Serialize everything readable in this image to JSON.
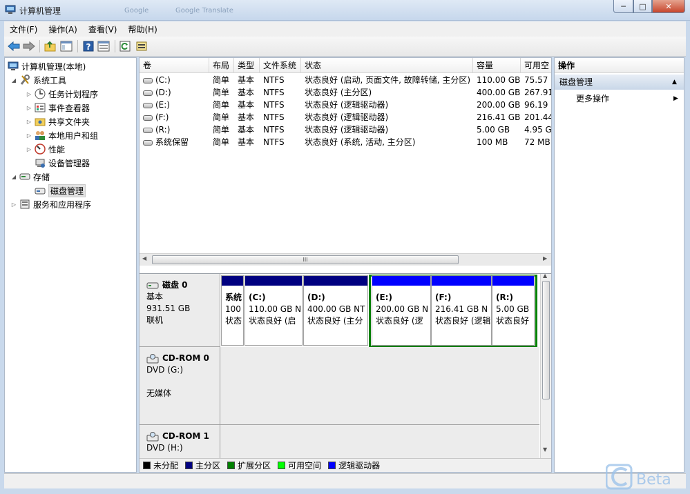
{
  "window": {
    "title": "计算机管理",
    "ghost_tabs": [
      "Google",
      "Google Translate"
    ],
    "minimize": "─",
    "maximize": "□",
    "close": "✕"
  },
  "menu": [
    "文件(F)",
    "操作(A)",
    "查看(V)",
    "帮助(H)"
  ],
  "toolbar_icons": [
    "back-arrow-icon",
    "forward-arrow-icon",
    "up-folder-icon",
    "show-hide-tree-icon",
    "help-icon",
    "properties-icon",
    "refresh-icon",
    "export-icon"
  ],
  "tree": {
    "root": "计算机管理(本地)",
    "system_tools": "系统工具",
    "task_scheduler": "任务计划程序",
    "event_viewer": "事件查看器",
    "shared_folders": "共享文件夹",
    "local_users": "本地用户和组",
    "performance": "性能",
    "device_manager": "设备管理器",
    "storage": "存储",
    "disk_management": "磁盘管理",
    "services_apps": "服务和应用程序"
  },
  "volume_table": {
    "columns": [
      "卷",
      "布局",
      "类型",
      "文件系统",
      "状态",
      "容量",
      "可用空"
    ],
    "rows": [
      [
        "(C:)",
        "简单",
        "基本",
        "NTFS",
        "状态良好 (启动, 页面文件, 故障转储, 主分区)",
        "110.00 GB",
        "75.57"
      ],
      [
        "(D:)",
        "简单",
        "基本",
        "NTFS",
        "状态良好 (主分区)",
        "400.00 GB",
        "267.91"
      ],
      [
        "(E:)",
        "简单",
        "基本",
        "NTFS",
        "状态良好 (逻辑驱动器)",
        "200.00 GB",
        "96.19"
      ],
      [
        "(F:)",
        "简单",
        "基本",
        "NTFS",
        "状态良好 (逻辑驱动器)",
        "216.41 GB",
        "201.44"
      ],
      [
        "(R:)",
        "简单",
        "基本",
        "NTFS",
        "状态良好 (逻辑驱动器)",
        "5.00 GB",
        "4.95 G"
      ],
      [
        "系统保留",
        "简单",
        "基本",
        "NTFS",
        "状态良好 (系统, 活动, 主分区)",
        "100 MB",
        "72 MB"
      ]
    ],
    "scroll_thumb_glyph": "III"
  },
  "disks": {
    "disk0": {
      "name": "磁盘 0",
      "type": "基本",
      "size": "931.51 GB",
      "status": "联机"
    },
    "cdrom0": {
      "name": "CD-ROM 0",
      "type": "DVD (G:)",
      "media": "无媒体"
    },
    "cdrom1": {
      "name": "CD-ROM 1",
      "type": "DVD (H:)"
    }
  },
  "partitions": [
    {
      "name": "系统",
      "size": "100",
      "status": "状态"
    },
    {
      "name": "(C:)",
      "size": "110.00 GB N",
      "status": "状态良好 (启"
    },
    {
      "name": "(D:)",
      "size": "400.00 GB NT",
      "status": "状态良好 (主分"
    },
    {
      "name": "(E:)",
      "size": "200.00 GB N",
      "status": "状态良好 (逻"
    },
    {
      "name": "(F:)",
      "size": "216.41 GB N",
      "status": "状态良好 (逻辑"
    },
    {
      "name": "(R:)",
      "size": "5.00 GB",
      "status": "状态良好"
    }
  ],
  "legend": [
    {
      "label": "未分配",
      "color": "#000000"
    },
    {
      "label": "主分区",
      "color": "#000080"
    },
    {
      "label": "扩展分区",
      "color": "#008000"
    },
    {
      "label": "可用空间",
      "color": "#00ff00"
    },
    {
      "label": "逻辑驱动器",
      "color": "#0000ff"
    }
  ],
  "actions": {
    "header": "操作",
    "section": "磁盘管理",
    "more": "更多操作"
  },
  "watermark": "Beta",
  "colors": {
    "primary_partition": "#000080",
    "logical_drive": "#0000ff",
    "extended_partition": "#008000"
  }
}
